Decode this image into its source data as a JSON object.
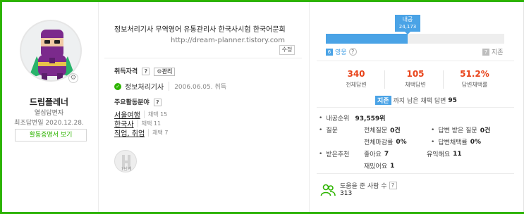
{
  "profile": {
    "nickname": "드림플레너",
    "rank": "열심답변자",
    "last_answer": "최조답변일 2020.12.28.",
    "certificate_button": "활동증명서 보기"
  },
  "intro": {
    "text": "정보처리기사 무역영어 유통관리사 한국사시험 한국어문회",
    "url": "http://dream-planner.tistory.com",
    "edit_label": "수정"
  },
  "license": {
    "title": "취득자격",
    "help": "?",
    "manage": "관리",
    "items": [
      {
        "name": "정보처리기사",
        "date": "2006.06.05. 취득"
      }
    ]
  },
  "fields": {
    "title": "주요활동분야",
    "help": "?",
    "items": [
      {
        "name": "서울여행",
        "count": "채택 15"
      },
      {
        "name": "한국사",
        "count": "채택 11"
      },
      {
        "name": "직업, 취업",
        "count": "채택 7"
      }
    ]
  },
  "badge": {
    "label": "1단계"
  },
  "grade": {
    "current": "내공",
    "points": "24,173",
    "progress_fraction": 0.46,
    "current_num": "6",
    "current_name": "영웅",
    "help": "?",
    "next_num": "7",
    "next_name": "지존"
  },
  "stats": [
    {
      "value": "340",
      "label": "전체답변"
    },
    {
      "value": "105",
      "label": "채택답변"
    },
    {
      "value": "51.2%",
      "label": "답변채택률"
    }
  ],
  "next_grade": {
    "tag": "지존",
    "text": "까지 남은 채택 답변",
    "count": "95"
  },
  "details": {
    "rank_label": "내공순위",
    "rank_value": "93,559위",
    "question_label": "질문",
    "total_q_label": "전체질문",
    "total_q_value": "0건",
    "answered_q_label": "답변 받은 질문",
    "answered_q_value": "0건",
    "close_rate_label": "전체마감률",
    "close_rate_value": "0%",
    "adopt_rate_label": "답변채택률",
    "adopt_rate_value": "0%",
    "rec_label": "받은추천",
    "good_label": "좋아요",
    "good_value": "7",
    "useful_label": "유익해요",
    "useful_value": "11",
    "fun_label": "재밌어요",
    "fun_value": "1"
  },
  "helped": {
    "label": "도움을 준 사람 수",
    "help": "?",
    "value": "313"
  },
  "colors": {
    "accent_green": "#2db400",
    "grade_blue": "#4aa3e6",
    "stat_red": "#e8441b"
  }
}
